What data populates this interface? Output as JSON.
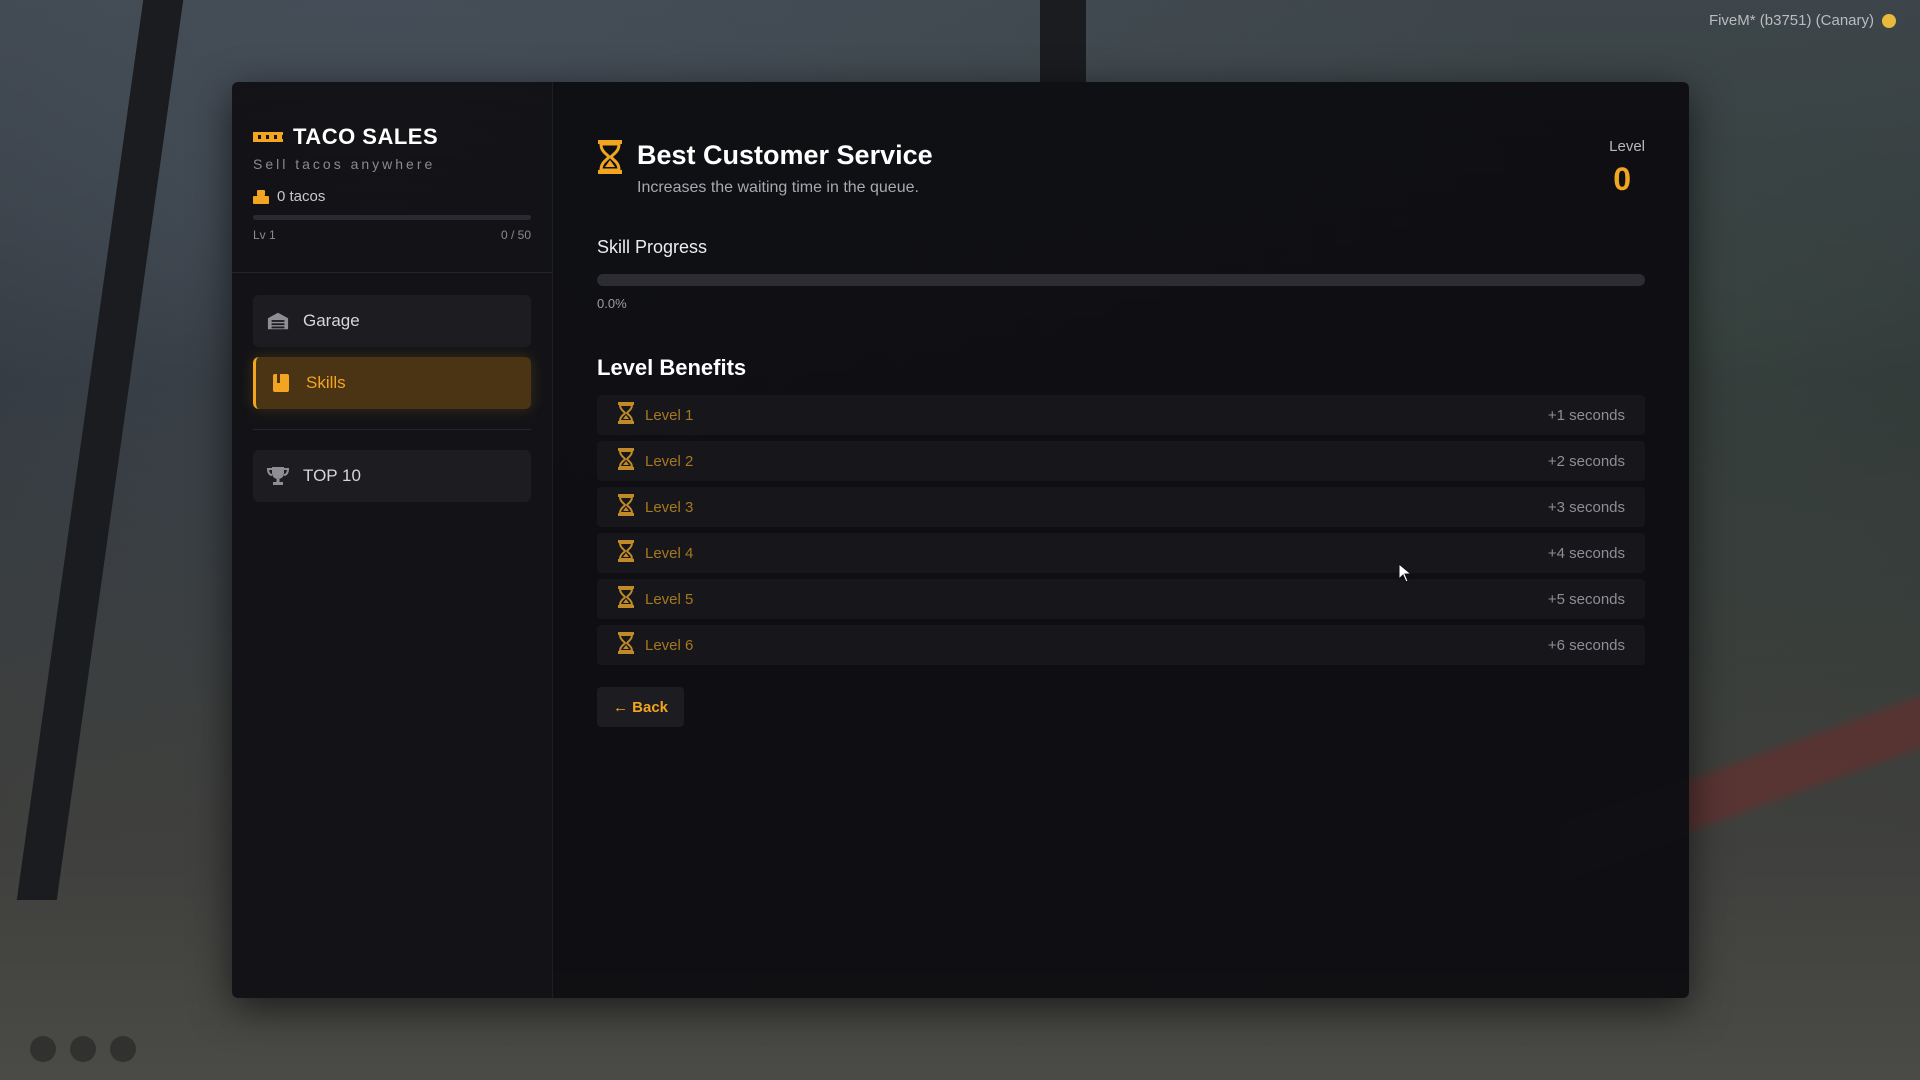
{
  "overlay": {
    "fivem_label": "FiveM* (b3751) (Canary)"
  },
  "sidebar": {
    "title": "TACO SALES",
    "subtitle": "Sell tacos anywhere",
    "taco_count": "0 tacos",
    "level_label": "Lv 1",
    "xp_text": "0 / 50",
    "xp_progress": 0,
    "nav": [
      {
        "label": "Garage",
        "icon": "garage-icon"
      },
      {
        "label": "Skills",
        "icon": "book-icon"
      },
      {
        "label": "TOP 10",
        "icon": "trophy-icon"
      }
    ]
  },
  "skill": {
    "title": "Best Customer Service",
    "description": "Increases the waiting time in the queue.",
    "level_label": "Level",
    "level_value": "0",
    "progress_title": "Skill Progress",
    "progress_percent_text": "0.0%",
    "progress_value": 0,
    "benefits_title": "Level Benefits",
    "benefits": [
      {
        "level": "Level 1",
        "value": "+1 seconds"
      },
      {
        "level": "Level 2",
        "value": "+2 seconds"
      },
      {
        "level": "Level 3",
        "value": "+3 seconds"
      },
      {
        "level": "Level 4",
        "value": "+4 seconds"
      },
      {
        "level": "Level 5",
        "value": "+5 seconds"
      },
      {
        "level": "Level 6",
        "value": "+6 seconds"
      }
    ],
    "back_label": "← Back"
  },
  "colors": {
    "accent": "#f2a520",
    "panel": "#0e0e12",
    "sidebar": "#121216"
  }
}
